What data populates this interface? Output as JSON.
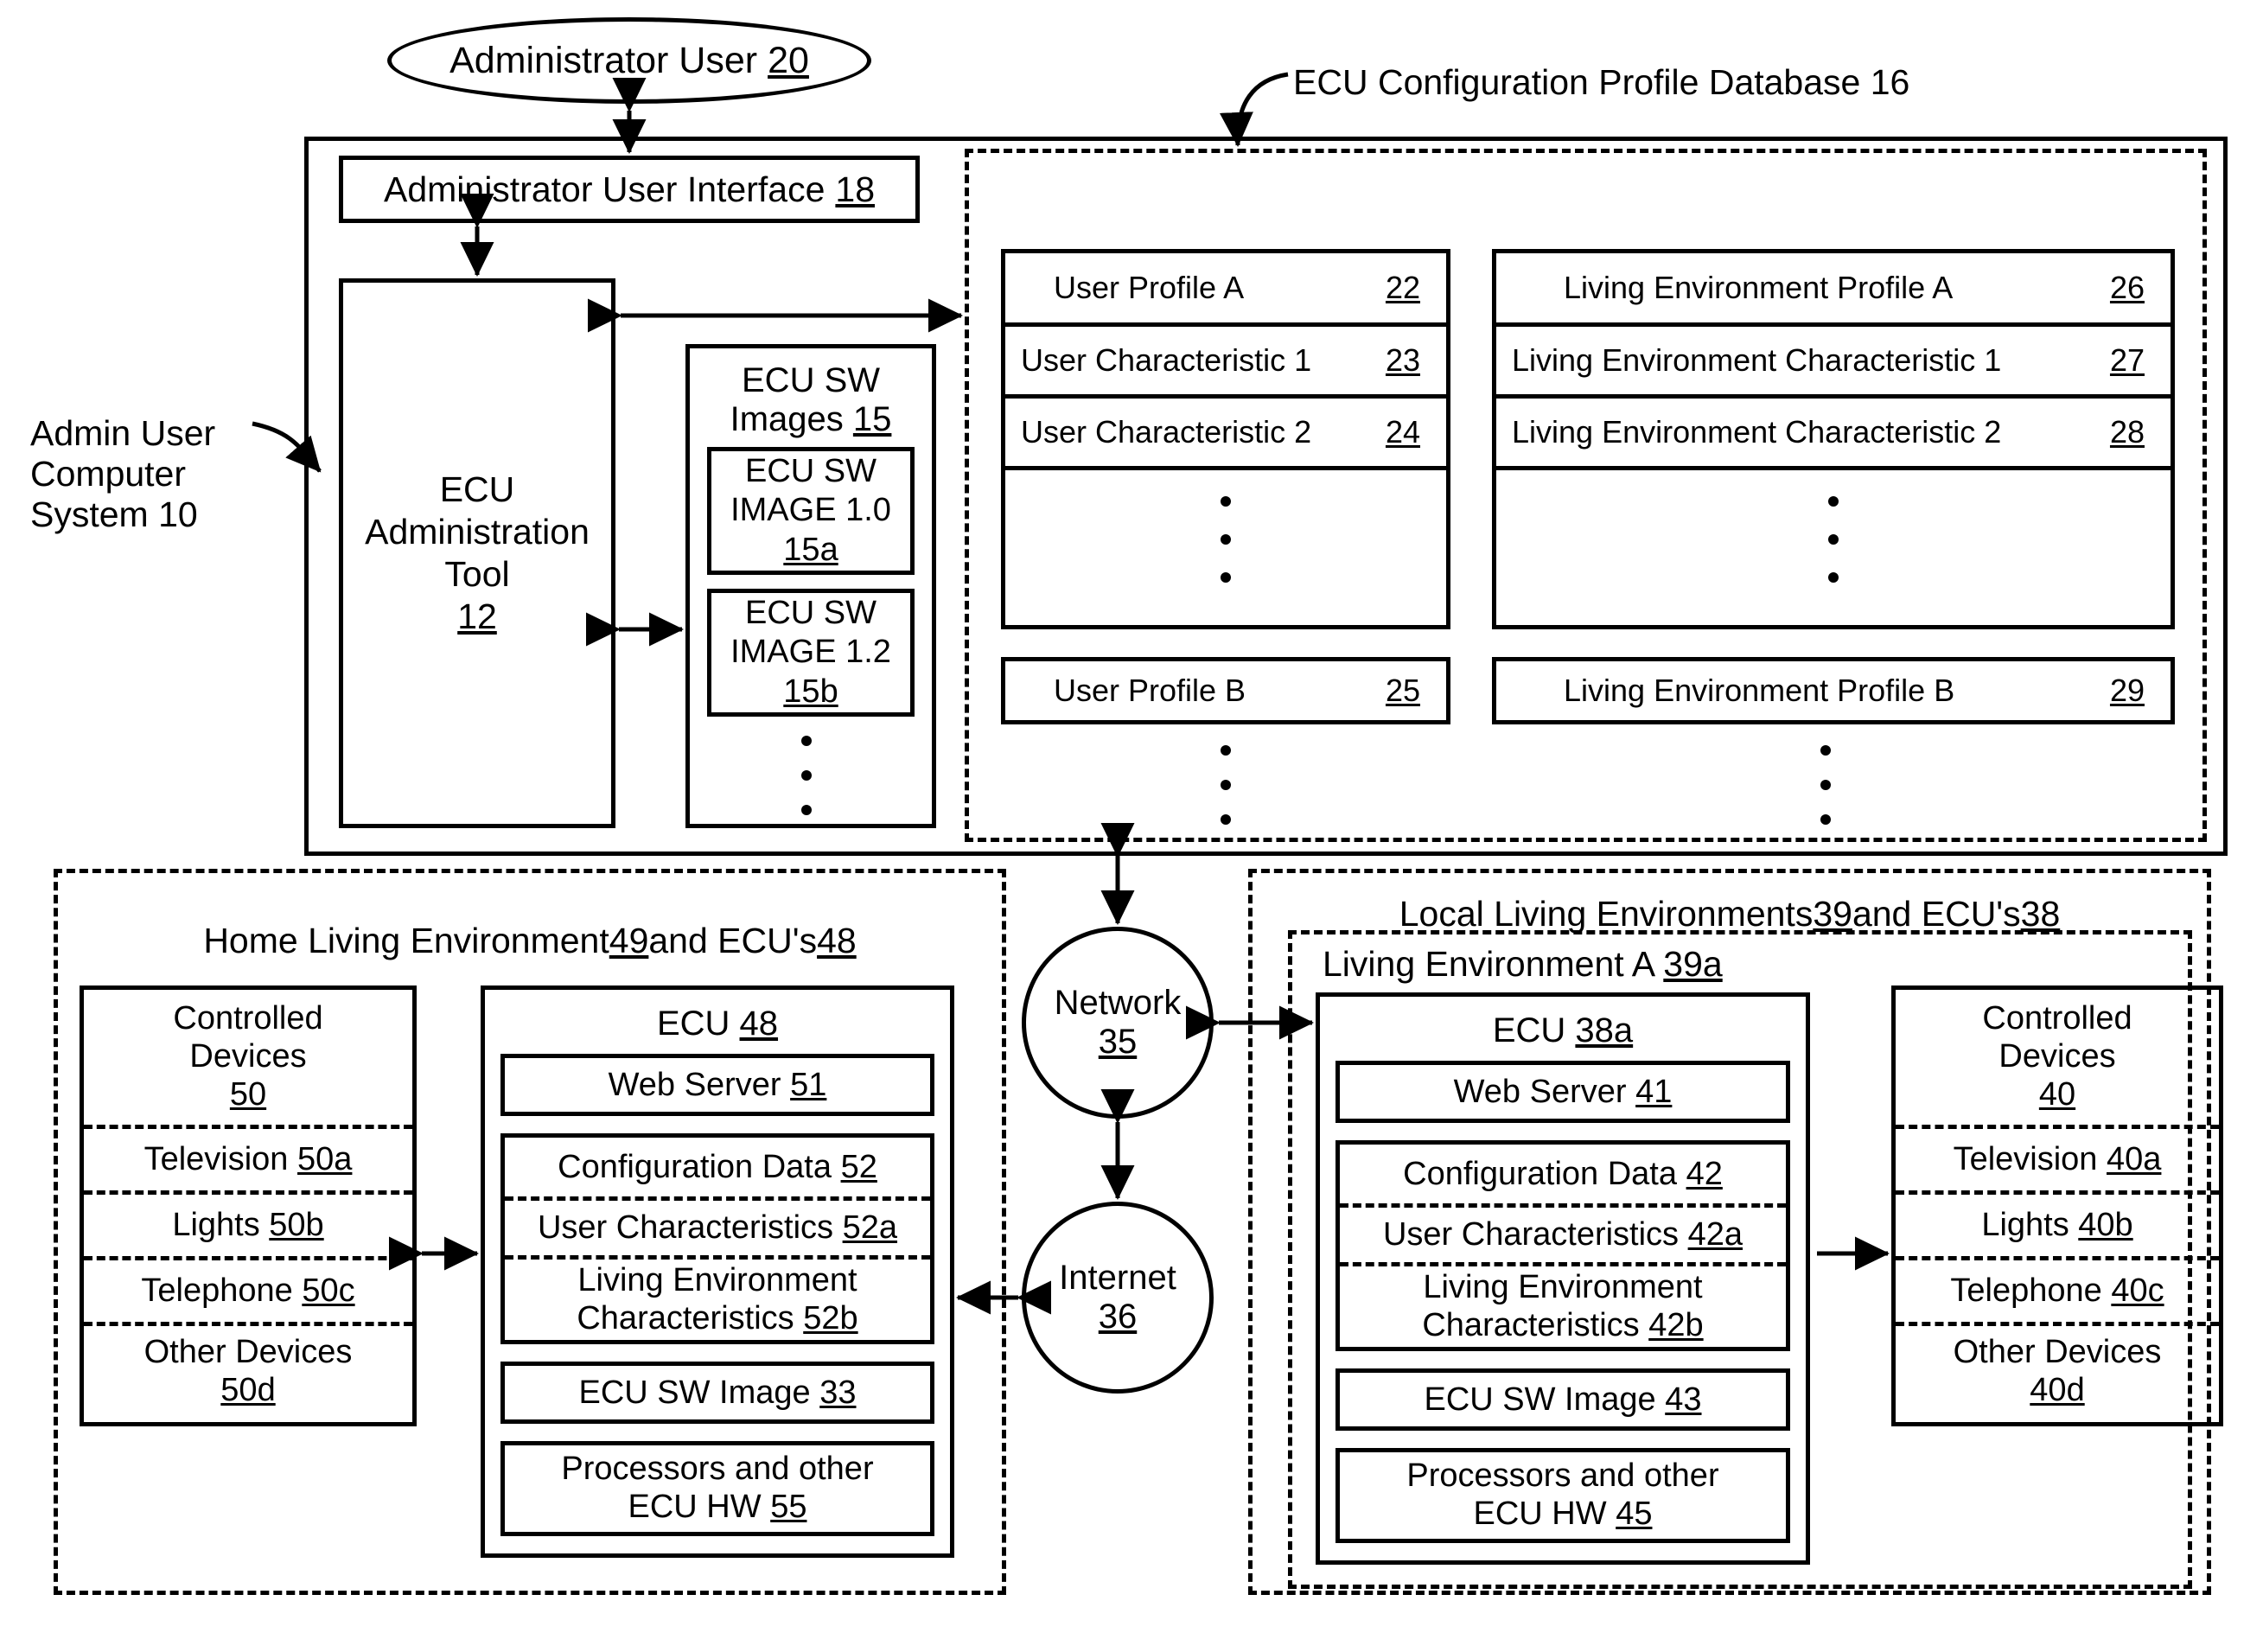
{
  "figure": {
    "actor": {
      "label": "Administrator User",
      "ref": "20"
    },
    "admin_system": {
      "label_line1": "Admin User",
      "label_line2": "Computer",
      "label_line3": "System 10"
    },
    "admin_ui": {
      "label": "Administrator User Interface",
      "ref": "18"
    },
    "admin_tool": {
      "line1": "ECU",
      "line2": "Administration",
      "line3": "Tool",
      "ref": "12"
    },
    "sw_images": {
      "title_line1": "ECU SW",
      "title_line2": "Images",
      "ref": "15",
      "items": [
        {
          "line1": "ECU SW",
          "line2": "IMAGE 1.0",
          "ref": "15a"
        },
        {
          "line1": "ECU SW",
          "line2": "IMAGE 1.2",
          "ref": "15b"
        }
      ]
    },
    "database": {
      "caption": "ECU Configuration Profile Database 16",
      "user_profile_a": {
        "rows": [
          {
            "label": "User Profile A",
            "ref": "22"
          },
          {
            "label": "User Characteristic 1",
            "ref": "23"
          },
          {
            "label": "User Characteristic 2",
            "ref": "24"
          }
        ]
      },
      "env_profile_a": {
        "rows": [
          {
            "label": "Living Environment Profile A",
            "ref": "26"
          },
          {
            "label": "Living Environment Characteristic 1",
            "ref": "27"
          },
          {
            "label": "Living Environment Characteristic 2",
            "ref": "28"
          }
        ]
      },
      "user_profile_b": {
        "label": "User Profile B",
        "ref": "25"
      },
      "env_profile_b": {
        "label": "Living Environment Profile B",
        "ref": "29"
      }
    },
    "home_env": {
      "caption_pre": "Home Living Environment ",
      "caption_ref1": "49",
      "caption_mid": " and ECU's ",
      "caption_ref2": "48",
      "controlled_devices": {
        "title_line1": "Controlled",
        "title_line2": "Devices",
        "ref": "50",
        "items": [
          {
            "label": "Television",
            "ref": "50a"
          },
          {
            "label": "Lights",
            "ref": "50b"
          },
          {
            "label": "Telephone",
            "ref": "50c"
          },
          {
            "label": "Other Devices",
            "ref": "50d"
          }
        ]
      },
      "ecu": {
        "title": "ECU",
        "ref": "48",
        "web_server": {
          "label": "Web Server",
          "ref": "51"
        },
        "config_data": {
          "label": "Configuration Data",
          "ref": "52"
        },
        "user_characteristics": {
          "label": "User Characteristics",
          "ref": "52a"
        },
        "env_characteristics_l1": "Living Environment",
        "env_characteristics_l2": "Characteristics",
        "env_characteristics_ref": "52b",
        "sw_image": {
          "label": "ECU SW Image",
          "ref": "33"
        },
        "hw_line1": "Processors and other",
        "hw_line2": "ECU HW",
        "hw_ref": "55"
      }
    },
    "network": {
      "label": "Network",
      "ref": "35"
    },
    "internet": {
      "label": "Internet",
      "ref": "36"
    },
    "local_envs": {
      "caption_pre": "Local Living Environments ",
      "caption_ref1": "39",
      "caption_mid": " and ECU's ",
      "caption_ref2": "38",
      "env_a_caption_pre": "Living Environment A ",
      "env_a_ref": "39a",
      "ecu": {
        "title": "ECU",
        "ref": "38a",
        "web_server": {
          "label": "Web Server",
          "ref": "41"
        },
        "config_data": {
          "label": "Configuration Data",
          "ref": "42"
        },
        "user_characteristics": {
          "label": "User Characteristics",
          "ref": "42a"
        },
        "env_characteristics_l1": "Living Environment",
        "env_characteristics_l2": "Characteristics",
        "env_characteristics_ref": "42b",
        "sw_image": {
          "label": "ECU SW Image",
          "ref": "43"
        },
        "hw_line1": "Processors and other",
        "hw_line2": "ECU HW",
        "hw_ref": "45"
      },
      "controlled_devices": {
        "title_line1": "Controlled",
        "title_line2": "Devices",
        "ref": "40",
        "items": [
          {
            "label": "Television",
            "ref": "40a"
          },
          {
            "label": "Lights",
            "ref": "40b"
          },
          {
            "label": "Telephone",
            "ref": "40c"
          },
          {
            "label": "Other Devices",
            "ref": "40d"
          }
        ]
      }
    }
  }
}
